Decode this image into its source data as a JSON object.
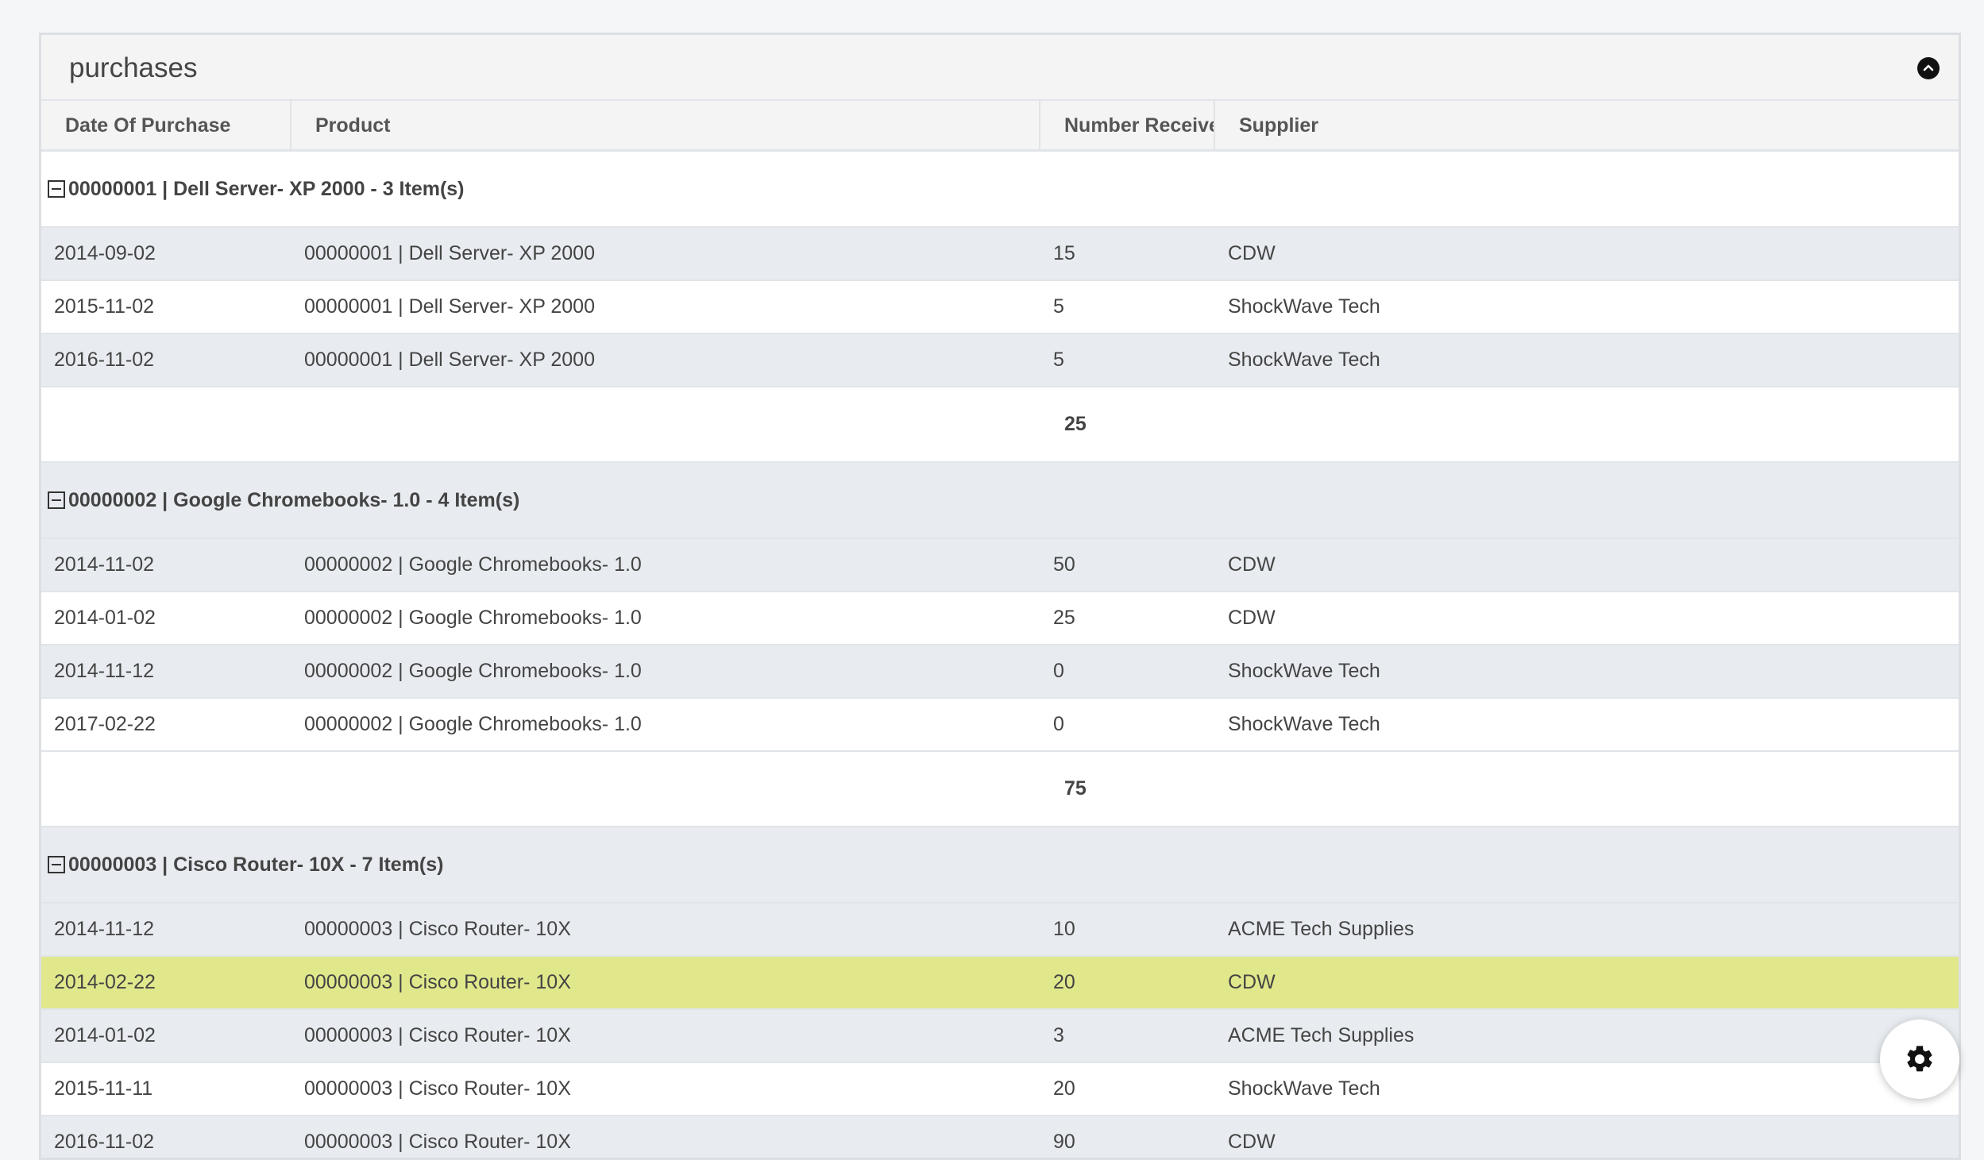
{
  "panel": {
    "title": "purchases"
  },
  "columns": [
    "Date Of Purchase",
    "Product",
    "Number Received",
    "Supplier"
  ],
  "groups": [
    {
      "label": "00000001 | Dell Server- XP 2000 - 3 Item(s)",
      "rows": [
        {
          "date": "2014-09-02",
          "product": "00000001 | Dell Server- XP 2000",
          "number": "15",
          "supplier": "CDW"
        },
        {
          "date": "2015-11-02",
          "product": "00000001 | Dell Server- XP 2000",
          "number": "5",
          "supplier": "ShockWave Tech"
        },
        {
          "date": "2016-11-02",
          "product": "00000001 | Dell Server- XP 2000",
          "number": "5",
          "supplier": "ShockWave Tech"
        }
      ],
      "total": "25"
    },
    {
      "label": "00000002 | Google Chromebooks- 1.0 - 4 Item(s)",
      "rows": [
        {
          "date": "2014-11-02",
          "product": "00000002 | Google Chromebooks- 1.0",
          "number": "50",
          "supplier": "CDW"
        },
        {
          "date": "2014-01-02",
          "product": "00000002 | Google Chromebooks- 1.0",
          "number": "25",
          "supplier": "CDW"
        },
        {
          "date": "2014-11-12",
          "product": "00000002 | Google Chromebooks- 1.0",
          "number": "0",
          "supplier": "ShockWave Tech"
        },
        {
          "date": "2017-02-22",
          "product": "00000002 | Google Chromebooks- 1.0",
          "number": "0",
          "supplier": "ShockWave Tech"
        }
      ],
      "total": "75"
    },
    {
      "label": "00000003 | Cisco Router- 10X - 7 Item(s)",
      "rows": [
        {
          "date": "2014-11-12",
          "product": "00000003 | Cisco Router- 10X",
          "number": "10",
          "supplier": "ACME Tech Supplies"
        },
        {
          "date": "2014-02-22",
          "product": "00000003 | Cisco Router- 10X",
          "number": "20",
          "supplier": "CDW",
          "selected": true
        },
        {
          "date": "2014-01-02",
          "product": "00000003 | Cisco Router- 10X",
          "number": "3",
          "supplier": "ACME Tech Supplies"
        },
        {
          "date": "2015-11-11",
          "product": "00000003 | Cisco Router- 10X",
          "number": "20",
          "supplier": "ShockWave Tech"
        },
        {
          "date": "2016-11-02",
          "product": "00000003 | Cisco Router- 10X",
          "number": "90",
          "supplier": "CDW"
        }
      ]
    }
  ],
  "colors": {
    "row_shaded": "#e8ecf0",
    "row_selected": "#e1e88c",
    "header_bg": "#f4f4f4"
  },
  "icons": {
    "collapse": "chevron-up-circle-icon",
    "group_toggle": "minus-square-icon",
    "settings": "gear-icon"
  }
}
